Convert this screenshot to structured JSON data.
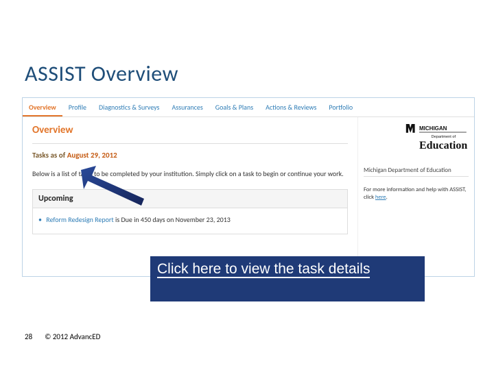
{
  "title": "ASSIST Overview",
  "tabs": [
    {
      "label": "Overview",
      "active": true
    },
    {
      "label": "Profile",
      "active": false
    },
    {
      "label": "Diagnostics & Surveys",
      "active": false
    },
    {
      "label": "Assurances",
      "active": false
    },
    {
      "label": "Goals & Plans",
      "active": false
    },
    {
      "label": "Actions & Reviews",
      "active": false
    },
    {
      "label": "Portfolio",
      "active": false
    }
  ],
  "section": {
    "heading": "Overview",
    "tasks_prefix": "Tasks as of ",
    "tasks_date": "August 29, 2012",
    "intro": "Below is a list of tasks to be completed by your institution. Simply click on a task to begin or continue your work.",
    "upcoming_label": "Upcoming",
    "upcoming_item_link": "Reform Redesign Report",
    "upcoming_item_rest": " is Due in 450 days on November 23, 2013"
  },
  "sidebar": {
    "logo_top": "MICHIGAN",
    "logo_sub": "Department of",
    "logo_main": "Education",
    "caption": "Michigan Department of Education",
    "help_prefix": "For more information and help with ASSIST, click ",
    "help_link": "here"
  },
  "callout": "Click here to view the task details",
  "footer": {
    "page": "28",
    "copyright": "© 2012 AdvancED"
  }
}
